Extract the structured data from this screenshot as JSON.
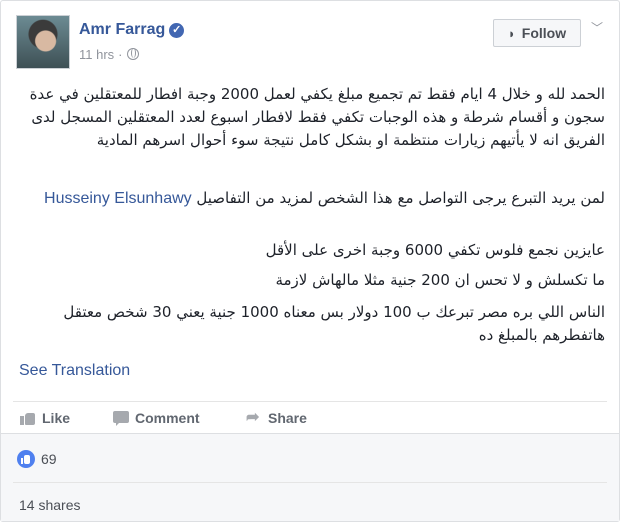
{
  "post": {
    "author": "Amr Farrag",
    "time": "11 hrs",
    "follow_label": "Follow",
    "paragraphs": {
      "p1": "الحمد لله و خلال 4 ايام فقط تم تجميع مبلغ يكفي لعمل 2000 وجبة افطار للمعتقلين في عدة سجون و أقسام شرطة و هذه الوجبات تكفي فقط لافطار اسبوع لعدد المعتقلين المسجل لدى الفريق انه لا يأتيهم زيارات منتظمة او بشكل كامل نتيجة سوء أحوال اسرهم المادية",
      "p2_text": "لمن يريد التبرع يرجى التواصل مع هذا الشخص لمزيد من التفاصيل",
      "p2_link": "Husseiny Elsunhawy",
      "p3": "عايزين نجمع فلوس تكفي 6000 وجبة اخرى على الأقل",
      "p4": "ما تكسلش و لا تحس ان 200 جنية مثلا مالهاش لازمة",
      "p5": "الناس اللي بره مصر تبرعك ب 100 دولار بس معناه 1000 جنية يعني 30 شخص معتقل هاتفطرهم بالمبلغ ده"
    },
    "see_translation": "See Translation",
    "actions": {
      "like": "Like",
      "comment": "Comment",
      "share": "Share"
    },
    "reaction_count": "69",
    "shares": "14 shares"
  },
  "colors": {
    "link": "#365899",
    "like_badge": "#4f80ef"
  }
}
